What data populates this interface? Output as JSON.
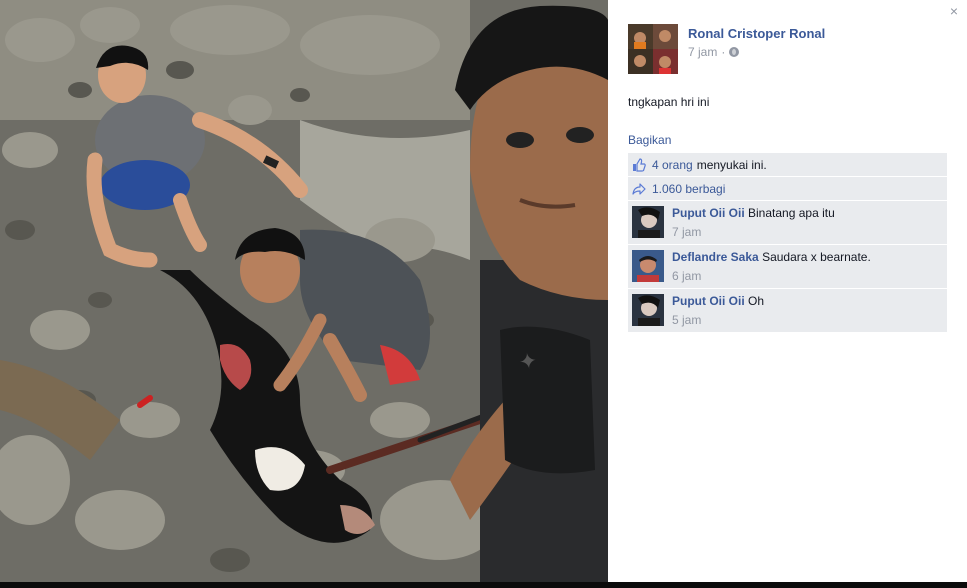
{
  "photo": {
    "description_icon": "photo-viewer"
  },
  "post": {
    "author_name": "Ronal Cristoper Ronal",
    "time": "7 jam",
    "time_separator": "·",
    "privacy_icon": "globe-icon",
    "caption": "tngkapan hri ini",
    "share_label": "Bagikan",
    "likes_count": "4 orang",
    "likes_suffix": "menyukai ini.",
    "shares_label": "1.060 berbagi"
  },
  "comments": [
    {
      "name": "Puput Oii Oii",
      "text": "Binatang apa itu",
      "time": "7 jam"
    },
    {
      "name": "Deflandre Saka",
      "text": "Saudara x bearnate.",
      "time": "6 jam"
    },
    {
      "name": "Puput Oii Oii",
      "text": "Oh",
      "time": "5 jam"
    }
  ],
  "close_icon": "×",
  "colors": {
    "link": "#3b5998",
    "muted": "#9197a3",
    "ufi_bg": "#e9ebee"
  }
}
